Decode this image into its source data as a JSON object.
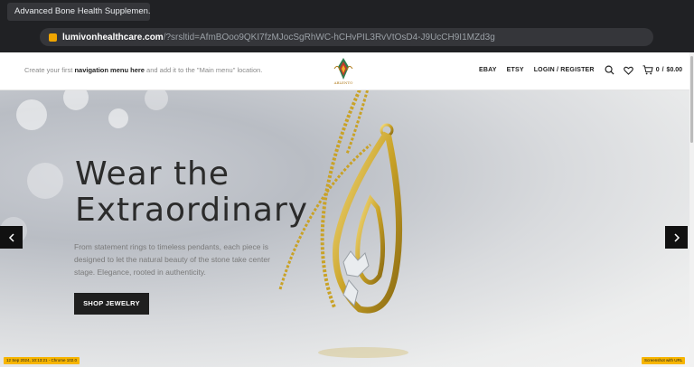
{
  "browser": {
    "tab_title": "Advanced Bone Health Supplemen...",
    "url_domain": "lumivonhealthcare.com",
    "url_path": "/?srsltid=AfmBOoo9QKI7fzMJocSgRhWC-hCHvPIL3RvVtOsD4-J9UcCH9I1MZd3g"
  },
  "header": {
    "nav_note_prefix": "Create your first ",
    "nav_note_bold": "navigation menu here",
    "nav_note_suffix": " and add it to the \"Main menu\" location.",
    "logo_text": "ABLENTO",
    "links": [
      "EBAY",
      "ETSY",
      "LOGIN / REGISTER"
    ],
    "cart_count": "0",
    "cart_total": "$0.00"
  },
  "hero": {
    "headline_line1": "Wear the",
    "headline_line2": "Extraordinary",
    "description": "From statement rings to timeless pendants, each piece is designed to let the natural beauty of the stone take center stage. Elegance, rooted in authenticity.",
    "cta_label": "SHOP JEWELRY"
  },
  "footer_badges": {
    "left": "12 Sep 2024, 10:13:21 - Chrome 102.0",
    "right": "Screenshot with URL"
  },
  "colors": {
    "accent_gold": "#c9a227",
    "button_dark": "#1f1f1f",
    "badge_yellow": "#f7b500"
  },
  "icons": [
    "search-icon",
    "heart-icon",
    "cart-icon",
    "chevron-left-icon",
    "chevron-right-icon"
  ]
}
